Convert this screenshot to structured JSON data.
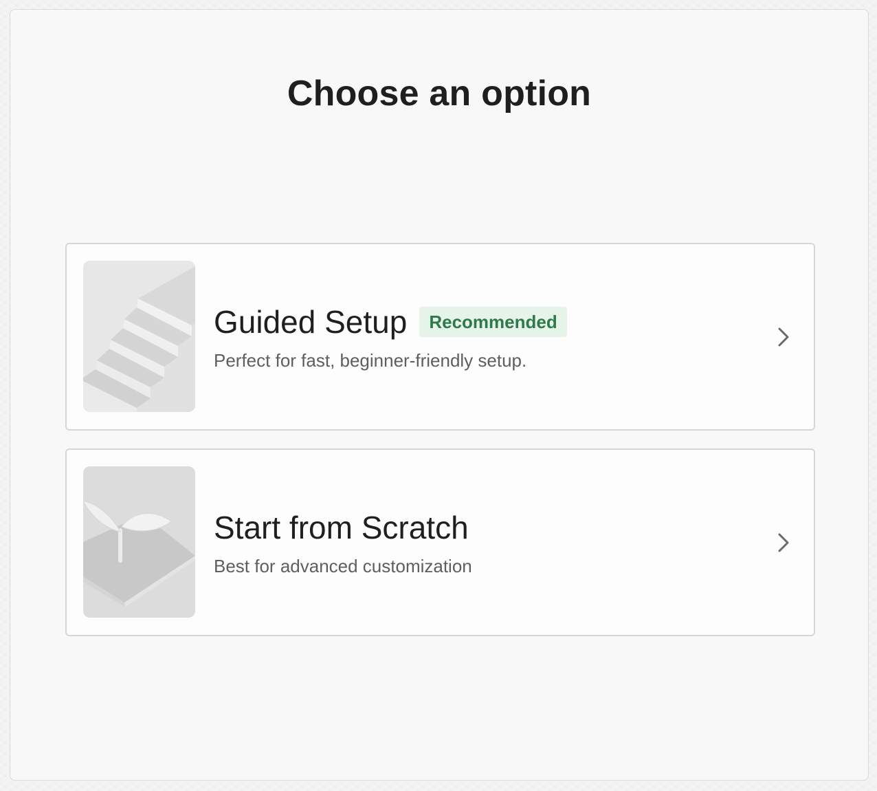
{
  "page": {
    "title": "Choose an option"
  },
  "options": [
    {
      "title": "Guided Setup",
      "badge": "Recommended",
      "description": "Perfect for fast, beginner-friendly setup.",
      "illustration": "staircase-illustration",
      "chevron_icon": "chevron-right-icon"
    },
    {
      "title": "Start from Scratch",
      "description": "Best for advanced customization",
      "illustration": "sprout-illustration",
      "chevron_icon": "chevron-right-icon"
    }
  ],
  "colors": {
    "badge_bg": "#e6f3e9",
    "badge_text": "#2f7a4a",
    "title_text": "#1f1f1f",
    "description_text": "#5e5e5e",
    "card_border": "#d6d6d6"
  }
}
